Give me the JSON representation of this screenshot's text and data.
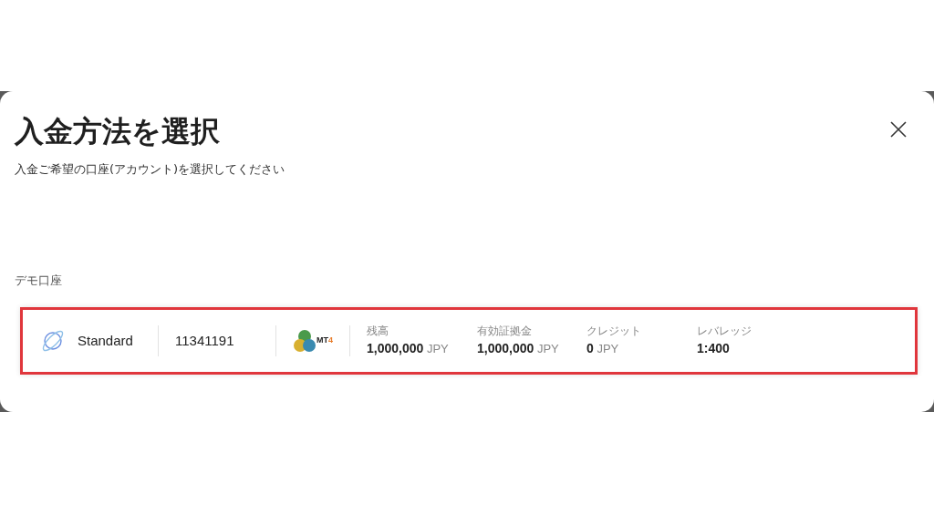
{
  "dialog": {
    "title": "入金方法を選択",
    "subtitle": "入金ご希望の口座(アカウント)を選択してください"
  },
  "section": {
    "title": "デモ口座"
  },
  "account": {
    "highlighted": true,
    "type": "Standard",
    "number": "11341191",
    "platform": "MT4",
    "stats": [
      {
        "label": "残高",
        "value": "1,000,000",
        "unit": "JPY"
      },
      {
        "label": "有効証拠金",
        "value": "1,000,000",
        "unit": "JPY"
      },
      {
        "label": "クレジット",
        "value": "0",
        "unit": "JPY"
      },
      {
        "label": "レバレッジ",
        "value": "1:400"
      }
    ]
  }
}
